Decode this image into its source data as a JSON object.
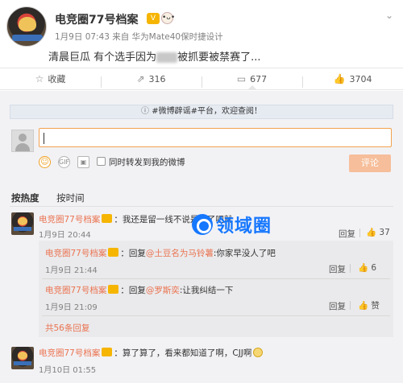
{
  "post": {
    "author": "电竞圈77号档案",
    "vip_badge": "V",
    "meta": "1月9日 07:43 来自 华为Mate40保时捷设计",
    "text_before": "清晨巨瓜 有个选手因为",
    "text_after": "被抓要被禁赛了...",
    "chevron": "⌄"
  },
  "actions": {
    "collect": {
      "icon": "☆",
      "label": "收藏"
    },
    "forward": {
      "icon": "⇗",
      "label": "316"
    },
    "comment": {
      "icon": "▭",
      "label": "677"
    },
    "like": {
      "icon": "👍",
      "label": "3704"
    }
  },
  "notice": {
    "text": "#微博辟谣#平台，欢迎查阅！"
  },
  "composer": {
    "checkbox_label": "同时转发到我的微博",
    "submit": "评论"
  },
  "sort": {
    "hot": "按热度",
    "time": "按时间"
  },
  "comments": [
    {
      "author": "电竞圈77号档案",
      "text": "：我还是留一线不说是谁了吧就",
      "time": "1月9日 20:44",
      "reply_label": "回复",
      "likes": "37"
    },
    {
      "author": "电竞圈77号档案",
      "prefix": "：回复",
      "mention": "@土豆名为马铃薯",
      "text": ":你家早没人了吧",
      "time": "1月9日 21:44",
      "reply_label": "回复",
      "likes": "6"
    },
    {
      "author": "电竞圈77号档案",
      "prefix": "：回复",
      "mention": "@罗斯奕",
      "text": ":让我纠结一下",
      "time": "1月9日 21:09",
      "reply_label": "回复",
      "likes": "赞"
    },
    {
      "author": "电竞圈77号档案",
      "text": "：算了算了，看来都知道了啊，CJJ啊",
      "time": "1月10日 01:55"
    }
  ],
  "more_replies": "共56条回复",
  "watermark": "领域圈"
}
